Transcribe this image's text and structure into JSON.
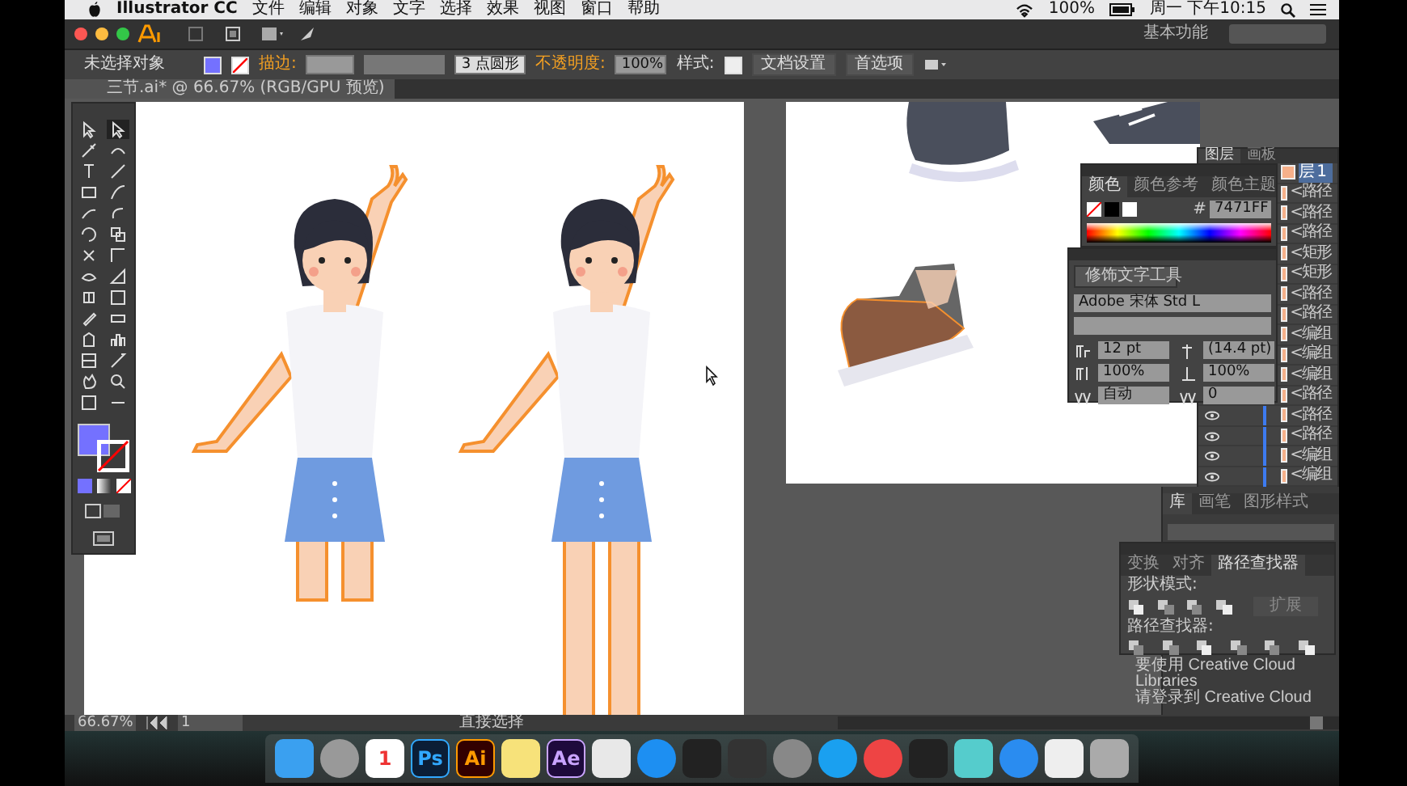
{
  "menubar": {
    "app": "Illustrator CC",
    "menus": [
      "文件",
      "编辑",
      "对象",
      "文字",
      "选择",
      "效果",
      "视图",
      "窗口",
      "帮助"
    ],
    "battery": "100%",
    "clock": "周一 下午10:15"
  },
  "titlebar": {
    "workspace": "基本功能"
  },
  "control_bar": {
    "selection": "未选择对象",
    "stroke_label": "描边:",
    "brush": "3 点圆形",
    "opacity_label": "不透明度:",
    "opacity": "100%",
    "style_label": "样式:",
    "buttons": [
      "文档设置",
      "首选项"
    ]
  },
  "document_tab": {
    "title": "三节.ai* @ 66.67% (RGB/GPU 预览)"
  },
  "toolbar": {
    "tools": [
      {
        "selected": false
      },
      {
        "selected": true
      },
      {
        "selected": false
      },
      {
        "selected": false
      },
      {
        "selected": false
      },
      {
        "selected": false
      },
      {
        "selected": false
      },
      {
        "selected": false
      },
      {
        "selected": false
      },
      {
        "selected": false
      },
      {
        "selected": false
      },
      {
        "selected": false
      },
      {
        "selected": false
      },
      {
        "selected": false
      },
      {
        "selected": false
      },
      {
        "selected": false
      },
      {
        "selected": false
      },
      {
        "selected": false
      },
      {
        "selected": false
      },
      {
        "selected": false
      },
      {
        "selected": false
      },
      {
        "selected": false
      },
      {
        "selected": false
      },
      {
        "selected": false
      },
      {
        "selected": false
      },
      {
        "selected": false
      },
      {
        "selected": false
      },
      {
        "selected": false
      }
    ]
  },
  "color_panel": {
    "tabs": [
      {
        "label": "颜色",
        "selected": true
      },
      {
        "label": "颜色参考",
        "selected": false
      },
      {
        "label": "颜色主题",
        "selected": false
      }
    ],
    "hex_label": "#",
    "hex": "7471FF"
  },
  "character_panel": {
    "touch_button": "修饰文字工具",
    "font": "Adobe 宋体 Std L",
    "fields": [
      "12 pt",
      "(14.4 pt)",
      "100%",
      "100%",
      "自动",
      "0"
    ]
  },
  "layers_panel": {
    "tabs": [
      {
        "label": "图层",
        "selected": true
      },
      {
        "label": "画板",
        "selected": false
      }
    ],
    "rows": [
      {
        "label": "层 1",
        "selected": true
      },
      {
        "label": "<路径",
        "selected": false
      },
      {
        "label": "<路径",
        "selected": false
      },
      {
        "label": "<路径",
        "selected": false
      },
      {
        "label": "<矩形",
        "selected": false
      },
      {
        "label": "<矩形",
        "selected": false
      },
      {
        "label": "<路径",
        "selected": false
      },
      {
        "label": "<路径",
        "selected": false
      },
      {
        "label": "<编组",
        "selected": false
      },
      {
        "label": "<编组",
        "selected": false
      },
      {
        "label": "<编组",
        "selected": false
      },
      {
        "label": "<路径",
        "selected": false
      },
      {
        "label": "<路径",
        "selected": false
      },
      {
        "label": "<路径",
        "selected": false
      },
      {
        "label": "<编组",
        "selected": false
      },
      {
        "label": "<编组",
        "selected": false
      }
    ]
  },
  "graphic_panel": {
    "tabs": [
      {
        "label": "库",
        "selected": true
      },
      {
        "label": "画笔",
        "selected": false
      },
      {
        "label": "图形样式",
        "selected": false
      }
    ]
  },
  "pathfinder_panel": {
    "tabs": [
      {
        "label": "变换",
        "selected": false
      },
      {
        "label": "对齐",
        "selected": false
      },
      {
        "label": "路径查找器",
        "selected": true
      }
    ],
    "shape_modes_label": "形状模式:",
    "expand_button": "扩展",
    "pathfinders_label": "路径查找器:"
  },
  "libraries_message": [
    "要使用 Creative Cloud Libraries",
    "请登录到 Creative Cloud"
  ],
  "status_bar": {
    "zoom": "66.67%",
    "artboard": "1",
    "tool": "直接选择"
  },
  "dock": [
    {
      "kind": "finder"
    },
    {
      "kind": "launchpad"
    },
    {
      "kind": "calendar",
      "text": "1"
    },
    {
      "kind": "ps",
      "text": "Ps"
    },
    {
      "kind": "ai",
      "text": "Ai"
    },
    {
      "kind": "notes"
    },
    {
      "kind": "ae",
      "text": "Ae"
    },
    {
      "kind": "preview"
    },
    {
      "kind": "appstore"
    },
    {
      "kind": "terminal"
    },
    {
      "kind": "unity"
    },
    {
      "kind": "settings"
    },
    {
      "kind": "browser"
    },
    {
      "kind": "chrome"
    },
    {
      "kind": "qq"
    },
    {
      "kind": "app"
    },
    {
      "kind": "safari"
    },
    {
      "kind": "document"
    },
    {
      "kind": "trash"
    }
  ]
}
